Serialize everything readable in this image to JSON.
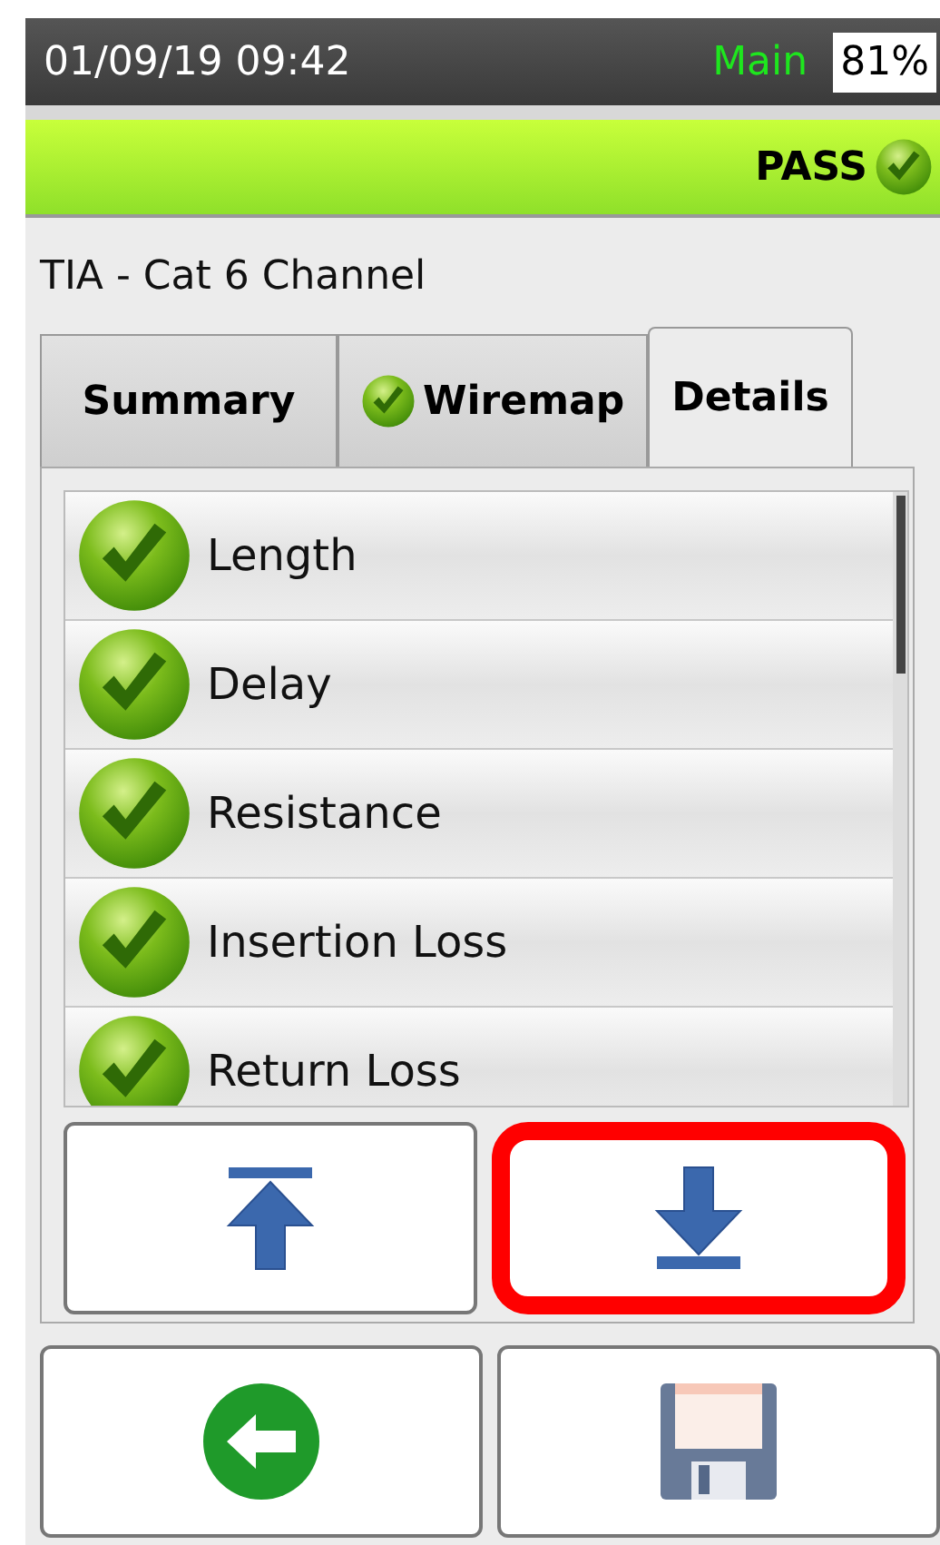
{
  "status_bar": {
    "datetime": "01/09/19 09:42",
    "profile": "Main",
    "battery": "81%"
  },
  "result_banner": {
    "label": "PASS",
    "passed": true
  },
  "test_title": "TIA - Cat 6 Channel",
  "tabs": [
    {
      "label": "Summary",
      "selected": false,
      "passed": false
    },
    {
      "label": "Wiremap",
      "selected": false,
      "passed": true
    },
    {
      "label": "Details",
      "selected": true,
      "passed": false
    }
  ],
  "results": [
    {
      "label": "Length",
      "passed": true
    },
    {
      "label": "Delay",
      "passed": true
    },
    {
      "label": "Resistance",
      "passed": true
    },
    {
      "label": "Insertion Loss",
      "passed": true
    },
    {
      "label": "Return Loss",
      "passed": true
    }
  ],
  "scroll_buttons": [
    {
      "kind": "top",
      "highlighted": false
    },
    {
      "kind": "down",
      "highlighted": true
    }
  ],
  "footer_buttons": [
    {
      "kind": "back"
    },
    {
      "kind": "save"
    }
  ]
}
